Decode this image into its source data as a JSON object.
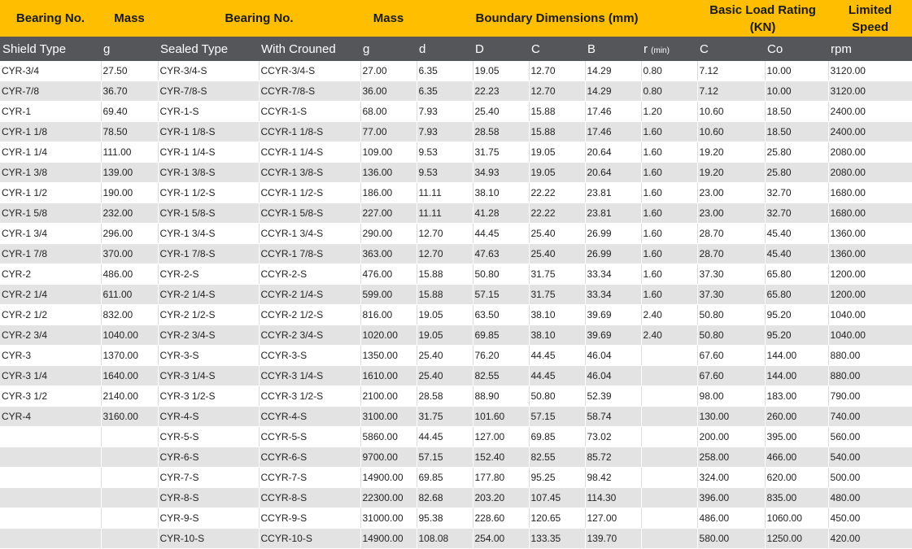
{
  "header_top": {
    "bearing_no_left": "Bearing No.",
    "mass_left": "Mass",
    "bearing_no_right": "Bearing No.",
    "mass_right": "Mass",
    "boundary_dimensions": "Boundary Dimensions (mm)",
    "basic_load_rating_line1": "Basic Load Rating",
    "basic_load_rating_line2": "(KN)",
    "limited_speed_line1": "Limited",
    "limited_speed_line2": "Speed"
  },
  "columns": [
    "Shield Type",
    "g",
    "Sealed Type",
    "With Crouned",
    "g",
    "d",
    "D",
    "C",
    "B",
    "r",
    "C",
    "Co",
    "rpm"
  ],
  "r_suffix": "(min)",
  "rows": [
    [
      "CYR-3/4",
      "27.50",
      "CYR-3/4-S",
      "CCYR-3/4-S",
      "27.00",
      "6.35",
      "19.05",
      "12.70",
      "14.29",
      "0.80",
      "7.12",
      "10.00",
      "3120.00"
    ],
    [
      "CYR-7/8",
      "36.70",
      "CYR-7/8-S",
      "CCYR-7/8-S",
      "36.00",
      "6.35",
      "22.23",
      "12.70",
      "14.29",
      "0.80",
      "7.12",
      "10.00",
      "3120.00"
    ],
    [
      "CYR-1",
      "69.40",
      "CYR-1-S",
      "CCYR-1-S",
      "68.00",
      "7.93",
      "25.40",
      "15.88",
      "17.46",
      "1.20",
      "10.60",
      "18.50",
      "2400.00"
    ],
    [
      "CYR-1 1/8",
      "78.50",
      "CYR-1 1/8-S",
      "CCYR-1 1/8-S",
      "77.00",
      "7.93",
      "28.58",
      "15.88",
      "17.46",
      "1.60",
      "10.60",
      "18.50",
      "2400.00"
    ],
    [
      "CYR-1 1/4",
      "111.00",
      "CYR-1 1/4-S",
      "CCYR-1 1/4-S",
      "109.00",
      "9.53",
      "31.75",
      "19.05",
      "20.64",
      "1.60",
      "19.20",
      "25.80",
      "2080.00"
    ],
    [
      "CYR-1 3/8",
      "139.00",
      "CYR-1 3/8-S",
      "CCYR-1 3/8-S",
      "136.00",
      "9.53",
      "34.93",
      "19.05",
      "20.64",
      "1.60",
      "19.20",
      "25.80",
      "2080.00"
    ],
    [
      "CYR-1 1/2",
      "190.00",
      "CYR-1 1/2-S",
      "CCYR-1 1/2-S",
      "186.00",
      "11.11",
      "38.10",
      "22.22",
      "23.81",
      "1.60",
      "23.00",
      "32.70",
      "1680.00"
    ],
    [
      "CYR-1 5/8",
      "232.00",
      "CYR-1 5/8-S",
      "CCYR-1 5/8-S",
      "227.00",
      "11.11",
      "41.28",
      "22.22",
      "23.81",
      "1.60",
      "23.00",
      "32.70",
      "1680.00"
    ],
    [
      "CYR-1 3/4",
      "296.00",
      "CYR-1 3/4-S",
      "CCYR-1 3/4-S",
      "290.00",
      "12.70",
      "44.45",
      "25.40",
      "26.99",
      "1.60",
      "28.70",
      "45.40",
      "1360.00"
    ],
    [
      "CYR-1 7/8",
      "370.00",
      "CYR-1 7/8-S",
      "CCYR-1 7/8-S",
      "363.00",
      "12.70",
      "47.63",
      "25.40",
      "26.99",
      "1.60",
      "28.70",
      "45.40",
      "1360.00"
    ],
    [
      "CYR-2",
      "486.00",
      "CYR-2-S",
      "CCYR-2-S",
      "476.00",
      "15.88",
      "50.80",
      "31.75",
      "33.34",
      "1.60",
      "37.30",
      "65.80",
      "1200.00"
    ],
    [
      "CYR-2 1/4",
      "611.00",
      "CYR-2 1/4-S",
      "CCYR-2 1/4-S",
      "599.00",
      "15.88",
      "57.15",
      "31.75",
      "33.34",
      "1.60",
      "37.30",
      "65.80",
      "1200.00"
    ],
    [
      "CYR-2 1/2",
      "832.00",
      "CYR-2 1/2-S",
      "CCYR-2 1/2-S",
      "816.00",
      "19.05",
      "63.50",
      "38.10",
      "39.69",
      "2.40",
      "50.80",
      "95.20",
      "1040.00"
    ],
    [
      "CYR-2 3/4",
      "1040.00",
      "CYR-2 3/4-S",
      "CCYR-2 3/4-S",
      "1020.00",
      "19.05",
      "69.85",
      "38.10",
      "39.69",
      "2.40",
      "50.80",
      "95.20",
      "1040.00"
    ],
    [
      "CYR-3",
      "1370.00",
      "CYR-3-S",
      "CCYR-3-S",
      "1350.00",
      "25.40",
      "76.20",
      "44.45",
      "46.04",
      "",
      "67.60",
      "144.00",
      "880.00"
    ],
    [
      "CYR-3 1/4",
      "1640.00",
      "CYR-3 1/4-S",
      "CCYR-3 1/4-S",
      "1610.00",
      "25.40",
      "82.55",
      "44.45",
      "46.04",
      "",
      "67.60",
      "144.00",
      "880.00"
    ],
    [
      "CYR-3 1/2",
      "2140.00",
      "CYR-3 1/2-S",
      "CCYR-3 1/2-S",
      "2100.00",
      "28.58",
      "88.90",
      "50.80",
      "52.39",
      "",
      "98.00",
      "183.00",
      "790.00"
    ],
    [
      "CYR-4",
      "3160.00",
      "CYR-4-S",
      "CCYR-4-S",
      "3100.00",
      "31.75",
      "101.60",
      "57.15",
      "58.74",
      "",
      "130.00",
      "260.00",
      "740.00"
    ],
    [
      "",
      "",
      "CYR-5-S",
      "CCYR-5-S",
      "5860.00",
      "44.45",
      "127.00",
      "69.85",
      "73.02",
      "",
      "200.00",
      "395.00",
      "560.00"
    ],
    [
      "",
      "",
      "CYR-6-S",
      "CCYR-6-S",
      "9700.00",
      "57.15",
      "152.40",
      "82.55",
      "85.72",
      "",
      "258.00",
      "466.00",
      "540.00"
    ],
    [
      "",
      "",
      "CYR-7-S",
      "CCYR-7-S",
      "14900.00",
      "69.85",
      "177.80",
      "95.25",
      "98.42",
      "",
      "324.00",
      "620.00",
      "500.00"
    ],
    [
      "",
      "",
      "CYR-8-S",
      "CCYR-8-S",
      "22300.00",
      "82.68",
      "203.20",
      "107.45",
      "114.30",
      "",
      "396.00",
      "835.00",
      "480.00"
    ],
    [
      "",
      "",
      "CYR-9-S",
      "CCYR-9-S",
      "31000.00",
      "95.38",
      "228.60",
      "120.65",
      "127.00",
      "",
      "486.00",
      "1060.00",
      "450.00"
    ],
    [
      "",
      "",
      "CYR-10-S",
      "CCYR-10-S",
      "14900.00",
      "108.08",
      "254.00",
      "133.35",
      "139.70",
      "",
      "580.00",
      "1250.00",
      "420.00"
    ]
  ]
}
